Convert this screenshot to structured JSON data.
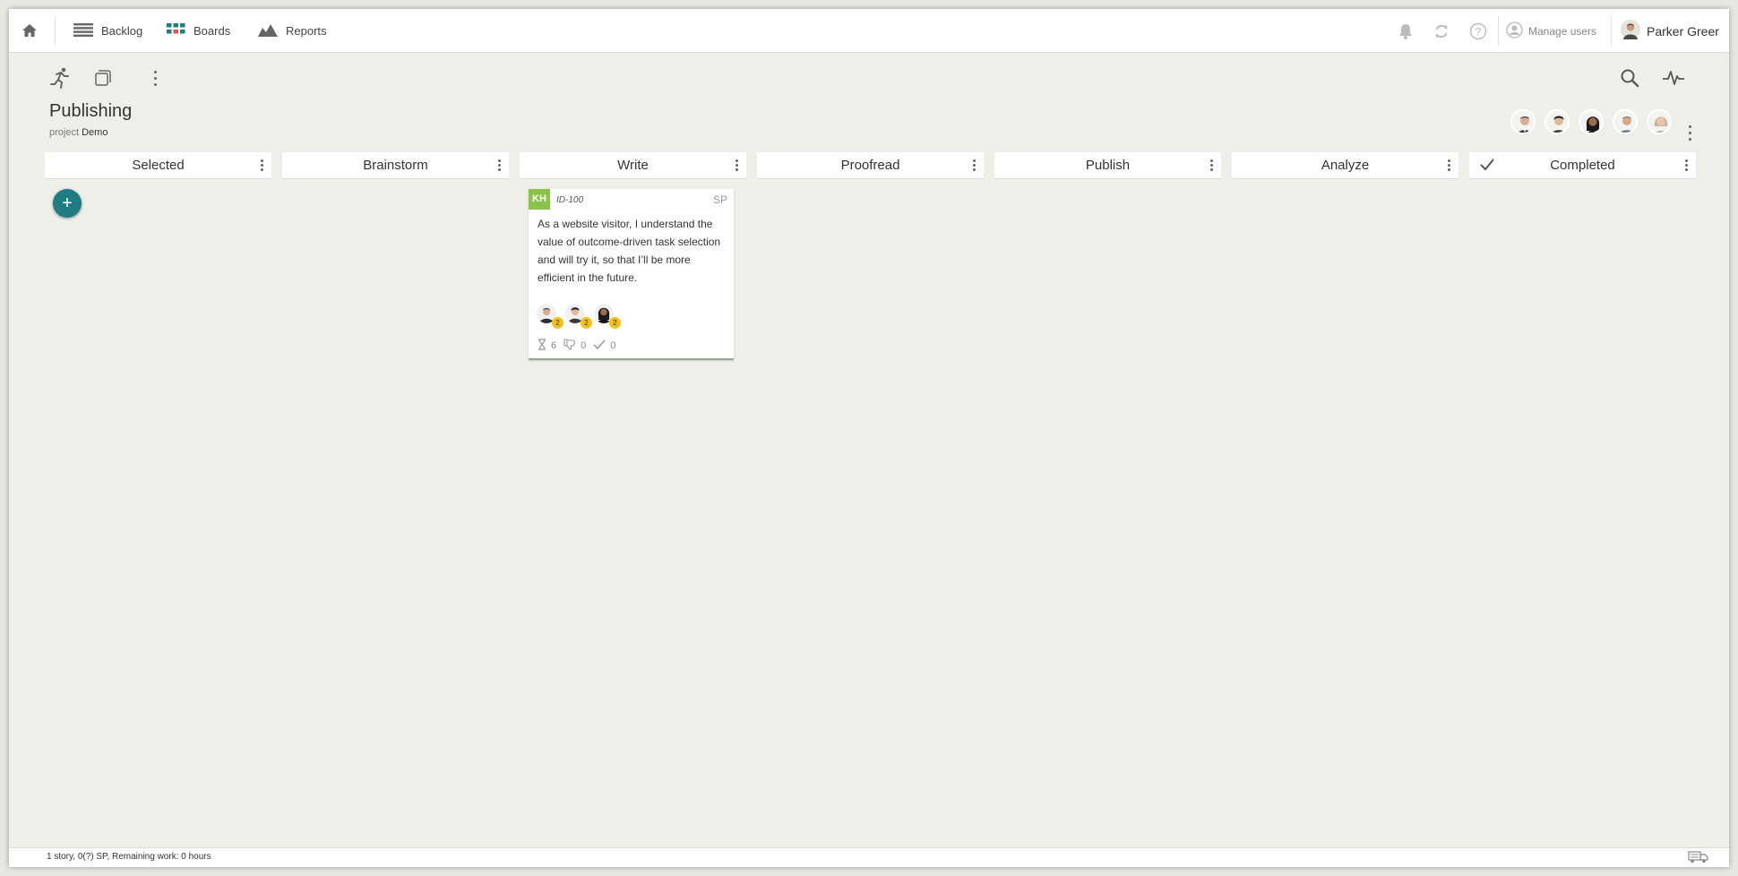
{
  "nav": {
    "home_icon": "home-icon",
    "items": [
      {
        "label": "Backlog",
        "icon": "backlog-list-icon"
      },
      {
        "label": "Boards",
        "icon": "boards-grid-icon"
      },
      {
        "label": "Reports",
        "icon": "reports-chart-icon"
      }
    ],
    "right_icons": [
      "bell-icon",
      "sync-icon",
      "help-icon"
    ],
    "manage_users_label": "Manage users",
    "user_name": "Parker Greer"
  },
  "toolbar": {
    "left_icons": [
      "sprint-runner-icon",
      "copy-icon",
      "more-vertical-icon"
    ],
    "right_icons": [
      "search-icon",
      "activity-pulse-icon"
    ]
  },
  "board": {
    "title": "Publishing",
    "subtitle_prefix": "project",
    "subtitle_project": "Demo",
    "member_avatars": 5,
    "columns": [
      {
        "title": "Selected"
      },
      {
        "title": "Brainstorm"
      },
      {
        "title": "Write"
      },
      {
        "title": "Proofread"
      },
      {
        "title": "Publish"
      },
      {
        "title": "Analyze"
      },
      {
        "title": "Completed",
        "checked": true
      }
    ],
    "add_button_label": "+"
  },
  "card": {
    "initials": "KH",
    "id": "ID-100",
    "sp_label": "SP",
    "text": "As a website visitor, I understand the value of outcome-driven task selection and will try it, so that I’ll be more efficient in the future.",
    "assignees": [
      {
        "badge": "2"
      },
      {
        "badge": "2"
      },
      {
        "badge": "2"
      }
    ],
    "stats": {
      "hours": "6",
      "impediments": "0",
      "done": "0"
    }
  },
  "status": {
    "text": "1 story, 0(?) SP, Remaining work: 0 hours"
  },
  "colors": {
    "accent": "#207c83",
    "initials_bg": "#8bc34a",
    "badge": "#f2c21b",
    "background": "#efefea"
  }
}
